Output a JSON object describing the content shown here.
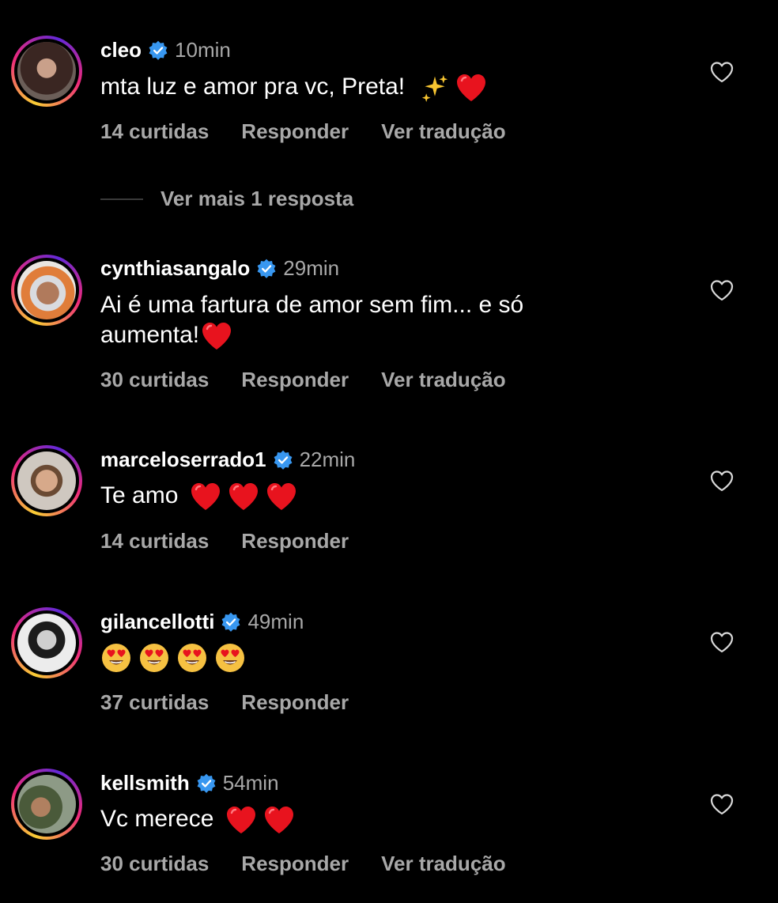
{
  "colors": {
    "background": "#000000",
    "text": "#ffffff",
    "muted": "#a8a8a8",
    "verified": "#3897f0",
    "heart": "#e0131c"
  },
  "comments": [
    {
      "username": "cleo",
      "time": "10min",
      "text": "mta luz e amor pra vc, Preta! ",
      "emojis": [
        "sparkles",
        "red-heart"
      ],
      "likes": "14 curtidas",
      "reply": "Responder",
      "translate": "Ver tradução",
      "view_replies": "Ver mais 1 resposta"
    },
    {
      "username": "cynthiasangalo",
      "time": "29min",
      "text": "Ai é uma fartura de amor sem fim... e só aumenta!",
      "emojis": [
        "red-heart"
      ],
      "likes": "30 curtidas",
      "reply": "Responder",
      "translate": "Ver tradução"
    },
    {
      "username": "marceloserrado1",
      "time": "22min",
      "text": "Te amo ",
      "emojis": [
        "red-heart",
        "red-heart",
        "red-heart"
      ],
      "likes": "14 curtidas",
      "reply": "Responder"
    },
    {
      "username": "gilancellotti",
      "time": "49min",
      "text": "",
      "emojis": [
        "heart-eyes",
        "heart-eyes",
        "heart-eyes",
        "heart-eyes"
      ],
      "likes": "37 curtidas",
      "reply": "Responder"
    },
    {
      "username": "kellsmith",
      "time": "54min",
      "text": "Vc merece ",
      "emojis": [
        "red-heart",
        "red-heart"
      ],
      "likes": "30 curtidas",
      "reply": "Responder",
      "translate": "Ver tradução"
    }
  ]
}
